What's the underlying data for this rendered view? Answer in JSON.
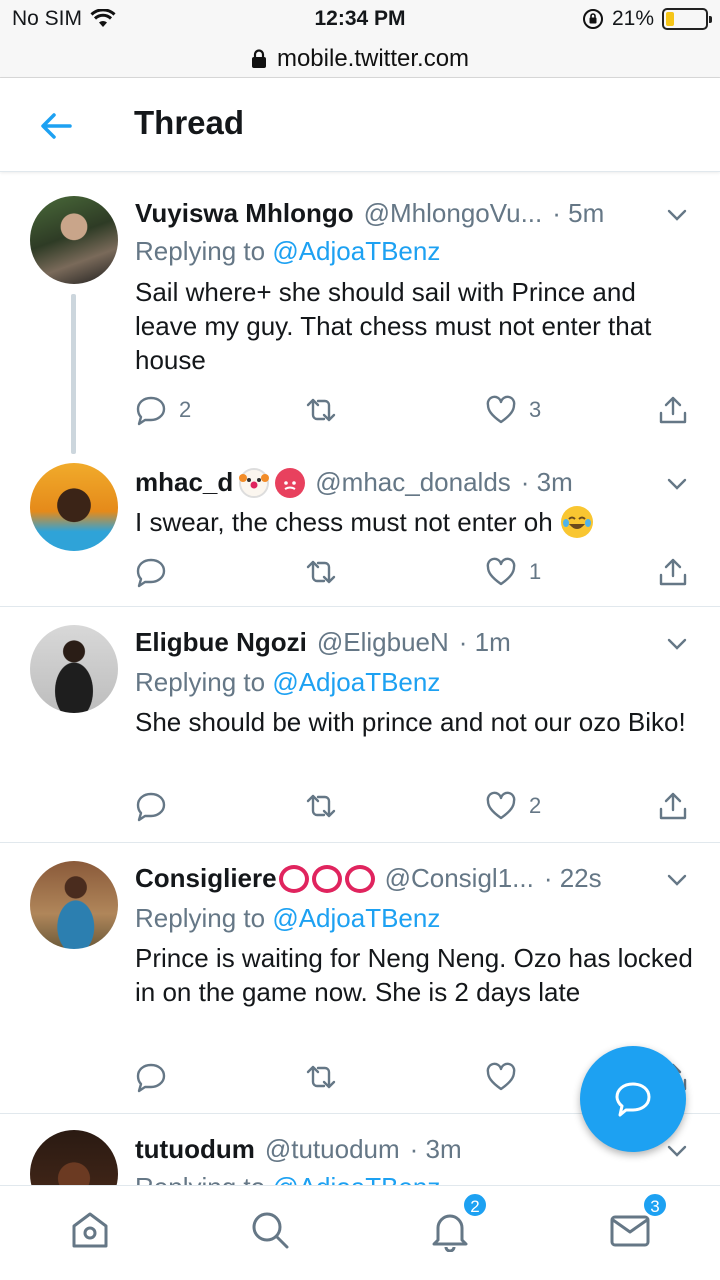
{
  "status_bar": {
    "carrier": "No SIM",
    "time": "12:34 PM",
    "battery": "21%",
    "battery_level": 0.21
  },
  "browser": {
    "url": "mobile.twitter.com"
  },
  "header": {
    "title": "Thread"
  },
  "tweets": [
    {
      "name": "Vuyiswa Mhlongo",
      "handle": "@MhlongoVu...",
      "time": "· 5m",
      "replying_prefix": "Replying to ",
      "replying_to": "@AdjoaTBenz",
      "text": "Sail where+ she should sail with Prince and leave my guy. That chess must not enter that house",
      "replies": "2",
      "retweets": "",
      "likes": "3"
    },
    {
      "name": "mhac_d",
      "handle": "@mhac_donalds",
      "time": "· 3m",
      "text": "I swear, the chess must not enter oh",
      "replies": "",
      "retweets": "",
      "likes": "1"
    },
    {
      "name": "Eligbue Ngozi",
      "handle": "@EligbueN",
      "time": "· 1m",
      "replying_prefix": "Replying to ",
      "replying_to": "@AdjoaTBenz",
      "text": "She should be with prince and not our ozo Biko!",
      "replies": "",
      "retweets": "",
      "likes": "2"
    },
    {
      "name": "Consigliere",
      "handle": "@Consigl1...",
      "time": "· 22s",
      "replying_prefix": "Replying to ",
      "replying_to": "@AdjoaTBenz",
      "text": "Prince is waiting for Neng Neng. Ozo has locked in on the game now. She is 2 days late",
      "replies": "",
      "retweets": "",
      "likes": ""
    },
    {
      "name": "tutuodum",
      "handle": "@tutuodum",
      "time": "· 3m",
      "replying_prefix": "Replying to ",
      "replying_to": "@AdjoaTBenz"
    }
  ],
  "nav": {
    "notifications_badge": "2",
    "messages_badge": "3"
  },
  "colors": {
    "accent": "#1da1f2",
    "text": "#14171a",
    "secondary": "#657786",
    "divider": "#e1e8ed",
    "circle_mark": "#e0245e"
  }
}
